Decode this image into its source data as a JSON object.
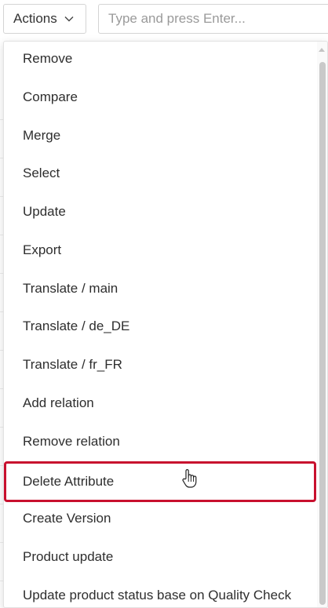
{
  "toolbar": {
    "actions_label": "Actions",
    "search_placeholder": "Type and press Enter..."
  },
  "menu": {
    "items": [
      {
        "label": "Remove"
      },
      {
        "label": "Compare"
      },
      {
        "label": "Merge"
      },
      {
        "label": "Select"
      },
      {
        "label": "Update"
      },
      {
        "label": "Export"
      },
      {
        "label": "Translate / main"
      },
      {
        "label": "Translate / de_DE"
      },
      {
        "label": "Translate / fr_FR"
      },
      {
        "label": "Add relation"
      },
      {
        "label": "Remove relation"
      },
      {
        "label": "Delete Attribute"
      },
      {
        "label": "Create Version"
      },
      {
        "label": "Product update"
      },
      {
        "label": "Update product status base on Quality Check"
      }
    ],
    "highlighted_item": "Delete Attribute",
    "highlight_color": "#c8102e"
  },
  "icons": {
    "actions_dropdown": "chevron-down-icon",
    "pointer": "hand-pointer-icon"
  }
}
